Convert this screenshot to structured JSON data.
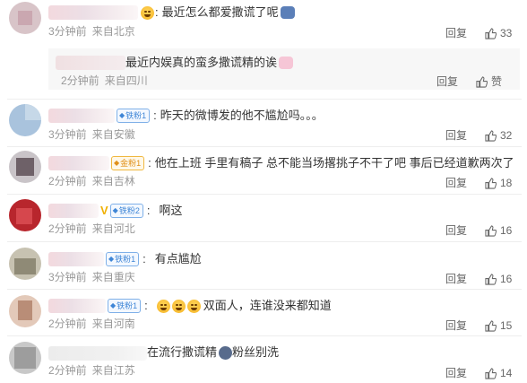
{
  "comments": [
    {
      "text": "最近怎么都爱撒谎了呢",
      "time": "3分钟前",
      "location": "来自北京",
      "reply": "回复",
      "likes": "33"
    },
    {
      "text": "最近内娱真的蛮多撒谎精的诶",
      "time": "2分钟前",
      "location": "来自四川",
      "reply": "回复",
      "likes": "赞"
    },
    {
      "text": "昨天的微博发的他不尴尬吗。。。",
      "time": "3分钟前",
      "location": "来自安徽",
      "reply": "回复",
      "likes": "32",
      "badge": "铁粉1"
    },
    {
      "text": "他在上班 手里有稿子 总不能当场撂挑子不干了吧 事后已经道歉两次了",
      "time": "2分钟前",
      "location": "来自吉林",
      "reply": "回复",
      "likes": "18",
      "badge": "金粉1"
    },
    {
      "text": "啊这",
      "time": "2分钟前",
      "location": "来自河北",
      "reply": "回复",
      "likes": "16",
      "badge": "铁粉2"
    },
    {
      "text": "有点尴尬",
      "time": "3分钟前",
      "location": "来自重庆",
      "reply": "回复",
      "likes": "16",
      "badge": "铁粉1"
    },
    {
      "text": "双面人，连谁没来都知道",
      "time": "2分钟前",
      "location": "来自河南",
      "reply": "回复",
      "likes": "15",
      "badge": "铁粉1"
    },
    {
      "text": "在流行撒谎精",
      "text2": "粉丝别洗",
      "time": "2分钟前",
      "location": "来自江苏",
      "reply": "回复",
      "likes": "14"
    }
  ],
  "colors": {
    "accent_blue": "#3f86d6",
    "gold": "#f0b840",
    "meta": "#999999"
  },
  "icons": {
    "like": "thumbs-up-icon",
    "badge": "diamond-icon"
  }
}
